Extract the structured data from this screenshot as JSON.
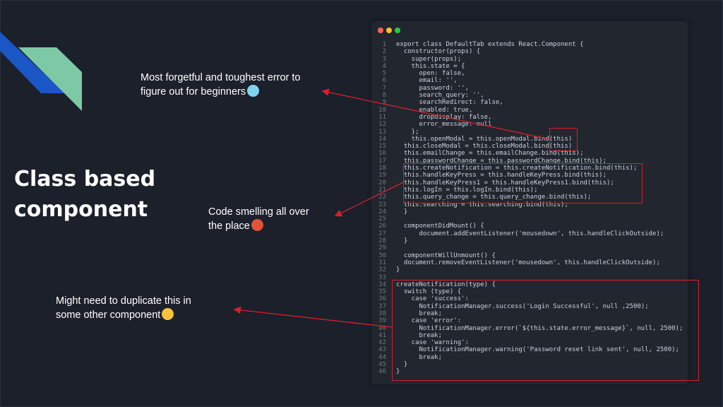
{
  "slide": {
    "title_lines": [
      "Class based",
      "component"
    ],
    "colors": {
      "background": "#1b202b",
      "deco_blue": "#1a56c6",
      "deco_green": "#7dc9a5",
      "arrow_red": "#d8202a",
      "code_bg": "#22262e"
    }
  },
  "annotations": {
    "forgetful": {
      "lines": [
        "Most forgetful and toughest error to",
        "figure out for beginners"
      ],
      "emoji": "cold-face-emoji"
    },
    "smelling": {
      "lines": [
        "Code smelling all over",
        "the place"
      ],
      "emoji": "nauseated-face-emoji"
    },
    "duplicate": {
      "lines": [
        "Might need to duplicate this in",
        "some other component"
      ],
      "emoji": "worried-face-emoji"
    }
  },
  "code_window": {
    "traffic_lights": [
      "#ff5f56",
      "#ffbd2e",
      "#27c93f"
    ],
    "lines": [
      {
        "n": "1",
        "text": "export class DefaultTab extends React.Component {"
      },
      {
        "n": "2",
        "text": "  constructor(props) {"
      },
      {
        "n": "3",
        "text": "    super(props);"
      },
      {
        "n": "4",
        "text": "    this.state = {"
      },
      {
        "n": "5",
        "text": "      open: false,"
      },
      {
        "n": "6",
        "text": "      email: '',"
      },
      {
        "n": "7",
        "text": "      password: '',"
      },
      {
        "n": "8",
        "text": "      search_query: '',"
      },
      {
        "n": "9",
        "text": "      searchRedirect: false,"
      },
      {
        "n": "10",
        "text": "      enabled: true,"
      },
      {
        "n": "11",
        "text": "      dropdisplay: false,"
      },
      {
        "n": "12",
        "text": "      error_message: null"
      },
      {
        "n": "13",
        "text": "    };"
      },
      {
        "n": "14",
        "text": "    this.openModal = this.openModal.bind(this)"
      },
      {
        "n": "15",
        "text": "  this.closeModal = this.closeModal.bind(this)"
      },
      {
        "n": "16",
        "text": "  this.emailChange = this.emailChange.bind(this);"
      },
      {
        "n": "17",
        "text": "  this.passwordChange = this.passwordChange.bind(this);"
      },
      {
        "n": "18",
        "text": "  this.createNotification = this.createNotification.bind(this);"
      },
      {
        "n": "19",
        "text": "  this.handleKeyPress = this.handleKeyPress.bind(this);"
      },
      {
        "n": "20",
        "text": "  this.handleKeyPress1 = this.handleKeyPress1.bind(this);"
      },
      {
        "n": "21",
        "text": "  this.logIn = this.logIn.bind(this);"
      },
      {
        "n": "22",
        "text": "  this.query_change = this.query_change.bind(this);"
      },
      {
        "n": "23",
        "text": "  this.searching = this.searching.bind(this);"
      },
      {
        "n": "24",
        "text": "  }"
      },
      {
        "n": "25",
        "text": ""
      },
      {
        "n": "26",
        "text": "  componentDidMount() {"
      },
      {
        "n": "27",
        "text": "      document.addEventListener('mousedown', this.handleClickOutside);"
      },
      {
        "n": "28",
        "text": "  }"
      },
      {
        "n": "29",
        "text": ""
      },
      {
        "n": "30",
        "text": "  componentWillUnmount() {"
      },
      {
        "n": "31",
        "text": "  document.removeEventListener('mousedown', this.handleClickOutside);"
      },
      {
        "n": "32",
        "text": "}"
      },
      {
        "n": "33",
        "text": ""
      },
      {
        "n": "34",
        "text": "createNotification(type) {"
      },
      {
        "n": "35",
        "text": "  switch (type) {"
      },
      {
        "n": "36",
        "text": "    case 'success':"
      },
      {
        "n": "37",
        "text": "      NotificationManager.success('Login Successful', null ,2500);"
      },
      {
        "n": "38",
        "text": "      break;"
      },
      {
        "n": "39",
        "text": "    case 'error':"
      },
      {
        "n": "40",
        "text": "      NotificationManager.error(`${this.state.error_message}`, null, 2500);"
      },
      {
        "n": "41",
        "text": "      break;"
      },
      {
        "n": "42",
        "text": "    case 'warning':"
      },
      {
        "n": "43",
        "text": "      NotificationManager.warning('Password reset link sent', null, 2500);"
      },
      {
        "n": "44",
        "text": "      break;"
      },
      {
        "n": "45",
        "text": "  }"
      },
      {
        "n": "46",
        "text": "}"
      }
    ]
  }
}
